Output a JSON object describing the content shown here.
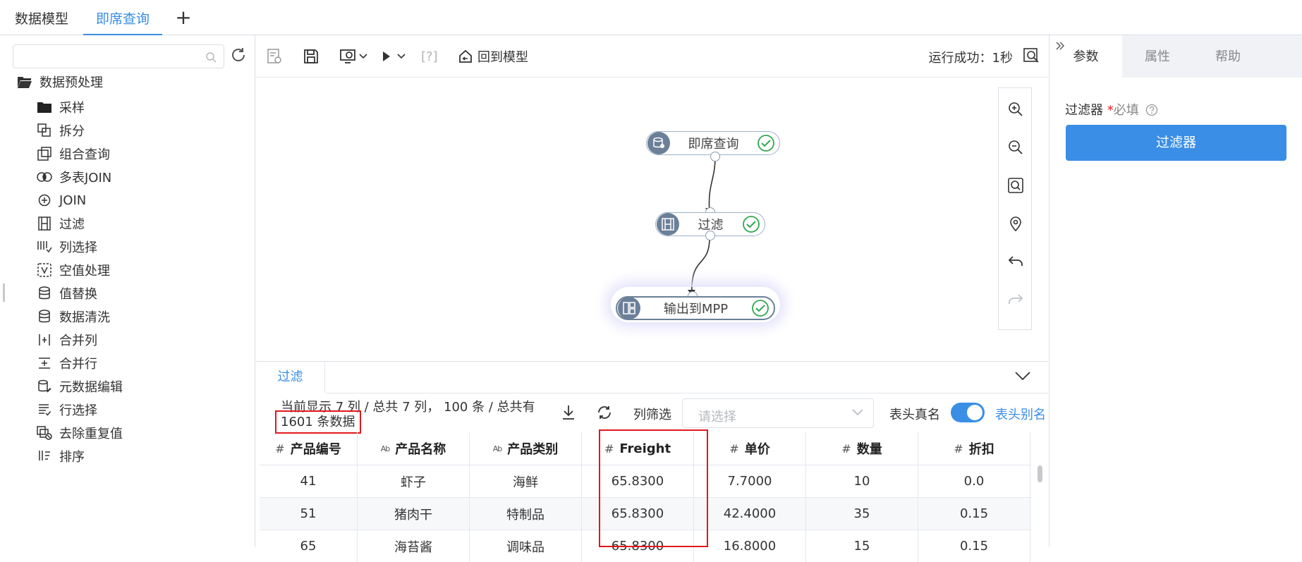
{
  "top_tabs": {
    "model": "数据模型",
    "adhoc": "即席查询",
    "add": "+"
  },
  "sidebar": {
    "search_placeholder": "",
    "root_label": "数据预处理",
    "items": [
      {
        "label": "采样",
        "icon": "folder-icon"
      },
      {
        "label": "拆分",
        "icon": "split-icon"
      },
      {
        "label": "组合查询",
        "icon": "combine-query-icon"
      },
      {
        "label": "多表JOIN",
        "icon": "multi-join-icon"
      },
      {
        "label": "JOIN",
        "icon": "join-icon"
      },
      {
        "label": "过滤",
        "icon": "filter-icon"
      },
      {
        "label": "列选择",
        "icon": "column-select-icon"
      },
      {
        "label": "空值处理",
        "icon": "null-handle-icon"
      },
      {
        "label": "值替换",
        "icon": "value-replace-icon"
      },
      {
        "label": "数据清洗",
        "icon": "data-clean-icon"
      },
      {
        "label": "合并列",
        "icon": "merge-columns-icon"
      },
      {
        "label": "合并行",
        "icon": "merge-rows-icon"
      },
      {
        "label": "元数据编辑",
        "icon": "metadata-edit-icon"
      },
      {
        "label": "行选择",
        "icon": "row-select-icon"
      },
      {
        "label": "去除重复值",
        "icon": "dedupe-icon"
      },
      {
        "label": "排序",
        "icon": "sort-icon"
      }
    ]
  },
  "toolbar": {
    "back_label": "回到模型",
    "run_status": "运行成功：1秒",
    "bracket_q": "[?]"
  },
  "flow": {
    "nodes": [
      {
        "label": "即席查询",
        "status": "success"
      },
      {
        "label": "过滤",
        "status": "success"
      },
      {
        "label": "输出到MPP",
        "status": "success"
      }
    ]
  },
  "bottom": {
    "tab_label": "过滤",
    "info_line1": "当前显示 7 列 / 总共 7 列， 100 条 / 总共有",
    "info_line2": "1601 条数据",
    "column_filter_label": "列筛选",
    "column_filter_placeholder": "请选择",
    "header_real_label": "表头真名",
    "header_alias_label": "表头别名",
    "header_toggle_on": true
  },
  "table": {
    "columns": [
      {
        "type": "#",
        "name": "产品编号"
      },
      {
        "type": "Ab",
        "name": "产品名称"
      },
      {
        "type": "Ab",
        "name": "产品类别"
      },
      {
        "type": "#",
        "name": "Freight"
      },
      {
        "type": "#",
        "name": "单价"
      },
      {
        "type": "#",
        "name": "数量"
      },
      {
        "type": "#",
        "name": "折扣"
      }
    ],
    "rows": [
      [
        "41",
        "虾子",
        "海鲜",
        "65.8300",
        "7.7000",
        "10",
        "0.0"
      ],
      [
        "51",
        "猪肉干",
        "特制品",
        "65.8300",
        "42.4000",
        "35",
        "0.15"
      ],
      [
        "65",
        "海苔酱",
        "调味品",
        "65.8300",
        "16.8000",
        "15",
        "0.15"
      ]
    ]
  },
  "right_panel": {
    "tabs": [
      "参数",
      "属性",
      "帮助"
    ],
    "filter_label": "过滤器",
    "required_star": "*",
    "required_text": "必填",
    "filter_button": "过滤器"
  },
  "colors": {
    "accent": "#3a8ee6",
    "highlight": "#e0191d",
    "node_icon_bg": "#6b7f98",
    "success": "#2fa84f"
  }
}
